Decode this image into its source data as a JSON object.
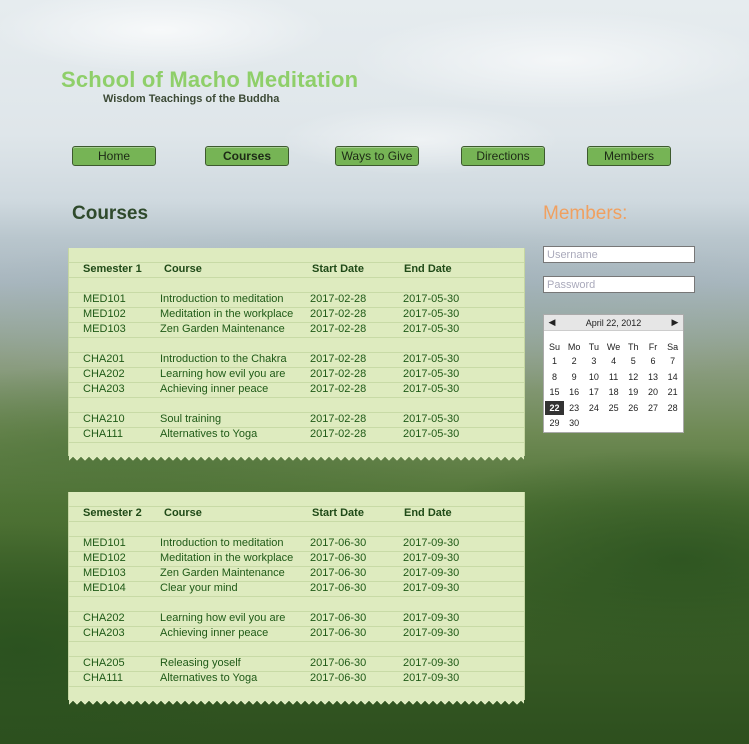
{
  "header": {
    "title": "School of Macho Meditation",
    "subtitle": "Wisdom Teachings of the Buddha"
  },
  "nav": [
    {
      "label": "Home",
      "active": false
    },
    {
      "label": "Courses",
      "active": true
    },
    {
      "label": "Ways to Give",
      "active": false
    },
    {
      "label": "Directions",
      "active": false
    },
    {
      "label": "Members",
      "active": false
    }
  ],
  "main": {
    "heading": "Courses",
    "semesters": [
      {
        "headers": [
          "Semester 1",
          "Course",
          "Start Date",
          "End Date"
        ],
        "groups": [
          [
            [
              "MED101",
              "Introduction to meditation",
              "2017-02-28",
              "2017-05-30"
            ],
            [
              "MED102",
              "Meditation in the workplace",
              "2017-02-28",
              "2017-05-30"
            ],
            [
              "MED103",
              "Zen Garden Maintenance",
              "2017-02-28",
              "2017-05-30"
            ]
          ],
          [
            [
              "CHA201",
              "Introduction to the Chakra",
              "2017-02-28",
              "2017-05-30"
            ],
            [
              "CHA202",
              "Learning how evil you are",
              "2017-02-28",
              "2017-05-30"
            ],
            [
              "CHA203",
              "Achieving inner peace",
              "2017-02-28",
              "2017-05-30"
            ]
          ],
          [
            [
              "CHA210",
              "Soul training",
              "2017-02-28",
              "2017-05-30"
            ],
            [
              "CHA111",
              "Alternatives to Yoga",
              "2017-02-28",
              "2017-05-30"
            ]
          ]
        ]
      },
      {
        "headers": [
          "Semester 2",
          "Course",
          "Start Date",
          "End Date"
        ],
        "groups": [
          [
            [
              "MED101",
              "Introduction to meditation",
              "2017-06-30",
              "2017-09-30"
            ],
            [
              "MED102",
              "Meditation in the workplace",
              "2017-06-30",
              "2017-09-30"
            ],
            [
              "MED103",
              "Zen Garden Maintenance",
              "2017-06-30",
              "2017-09-30"
            ],
            [
              "MED104",
              "Clear your mind",
              "2017-06-30",
              "2017-09-30"
            ]
          ],
          [
            [
              "CHA202",
              "Learning how evil you are",
              "2017-06-30",
              "2017-09-30"
            ],
            [
              "CHA203",
              "Achieving inner peace",
              "2017-06-30",
              "2017-09-30"
            ]
          ],
          [
            [
              "CHA205",
              "Releasing yoself",
              "2017-06-30",
              "2017-09-30"
            ],
            [
              "CHA111",
              "Alternatives to Yoga",
              "2017-06-30",
              "2017-09-30"
            ]
          ]
        ]
      }
    ]
  },
  "sidebar": {
    "title": "Members:",
    "username_placeholder": "Username",
    "password_placeholder": "Password",
    "calendar": {
      "month_label": "April 22, 2012",
      "prev_icon": "◀",
      "next_icon": "▶",
      "weekdays": [
        "Su",
        "Mo",
        "Tu",
        "We",
        "Th",
        "Fr",
        "Sa"
      ],
      "weeks": [
        [
          "1",
          "2",
          "3",
          "4",
          "5",
          "6",
          "7"
        ],
        [
          "8",
          "9",
          "10",
          "11",
          "12",
          "13",
          "14"
        ],
        [
          "15",
          "16",
          "17",
          "18",
          "19",
          "20",
          "21"
        ],
        [
          "22",
          "23",
          "24",
          "25",
          "26",
          "27",
          "28"
        ],
        [
          "29",
          "30"
        ]
      ],
      "selected": "22"
    }
  }
}
